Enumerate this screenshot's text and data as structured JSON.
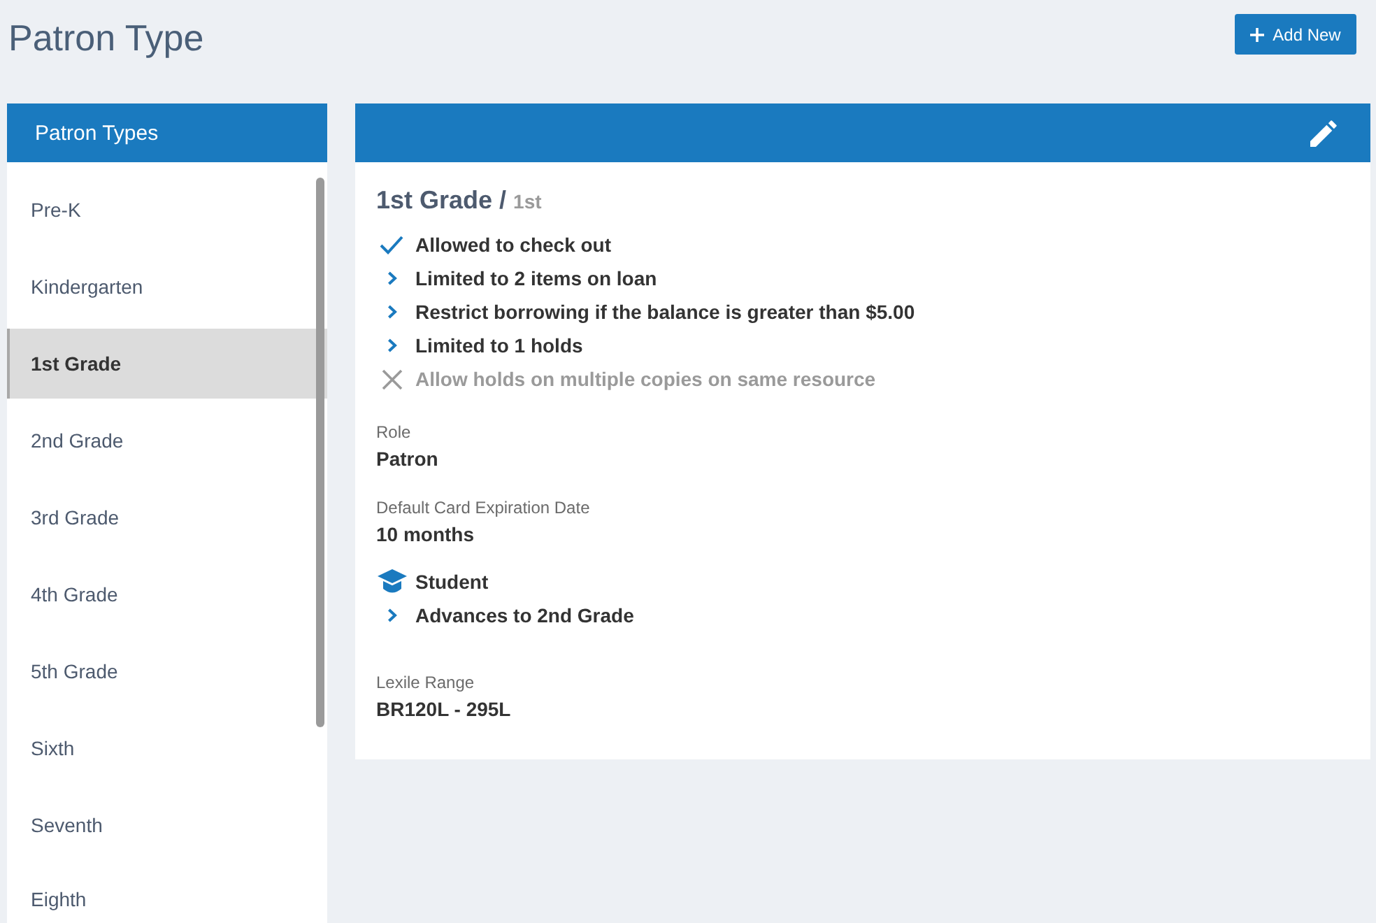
{
  "page": {
    "title": "Patron Type",
    "add_button": "Add New"
  },
  "sidebar": {
    "title": "Patron Types",
    "items": [
      {
        "label": "Pre-K",
        "selected": false
      },
      {
        "label": "Kindergarten",
        "selected": false
      },
      {
        "label": "1st Grade",
        "selected": true
      },
      {
        "label": "2nd Grade",
        "selected": false
      },
      {
        "label": "3rd Grade",
        "selected": false
      },
      {
        "label": "4th Grade",
        "selected": false
      },
      {
        "label": "5th Grade",
        "selected": false
      },
      {
        "label": "Sixth",
        "selected": false
      },
      {
        "label": "Seventh",
        "selected": false
      },
      {
        "label": "Eighth",
        "selected": false
      }
    ]
  },
  "detail": {
    "name": "1st Grade",
    "separator": "/",
    "code": "1st",
    "rules": [
      {
        "kind": "check",
        "text": "Allowed to check out",
        "disabled": false
      },
      {
        "kind": "chevron",
        "text": "Limited to 2 items on loan",
        "disabled": false
      },
      {
        "kind": "chevron",
        "text": "Restrict borrowing if the balance is greater than $5.00",
        "disabled": false
      },
      {
        "kind": "chevron",
        "text": "Limited to 1 holds",
        "disabled": false
      },
      {
        "kind": "cross",
        "text": "Allow holds on multiple copies on same resource",
        "disabled": true
      }
    ],
    "fields": [
      {
        "label": "Role",
        "value": "Patron"
      },
      {
        "label": "Default Card Expiration Date",
        "value": "10 months"
      }
    ],
    "student_rules": [
      {
        "kind": "cap",
        "text": "Student",
        "disabled": false
      },
      {
        "kind": "chevron",
        "text": "Advances to 2nd Grade",
        "disabled": false
      }
    ],
    "lexile": {
      "label": "Lexile Range",
      "value": "BR120L - 295L"
    }
  }
}
